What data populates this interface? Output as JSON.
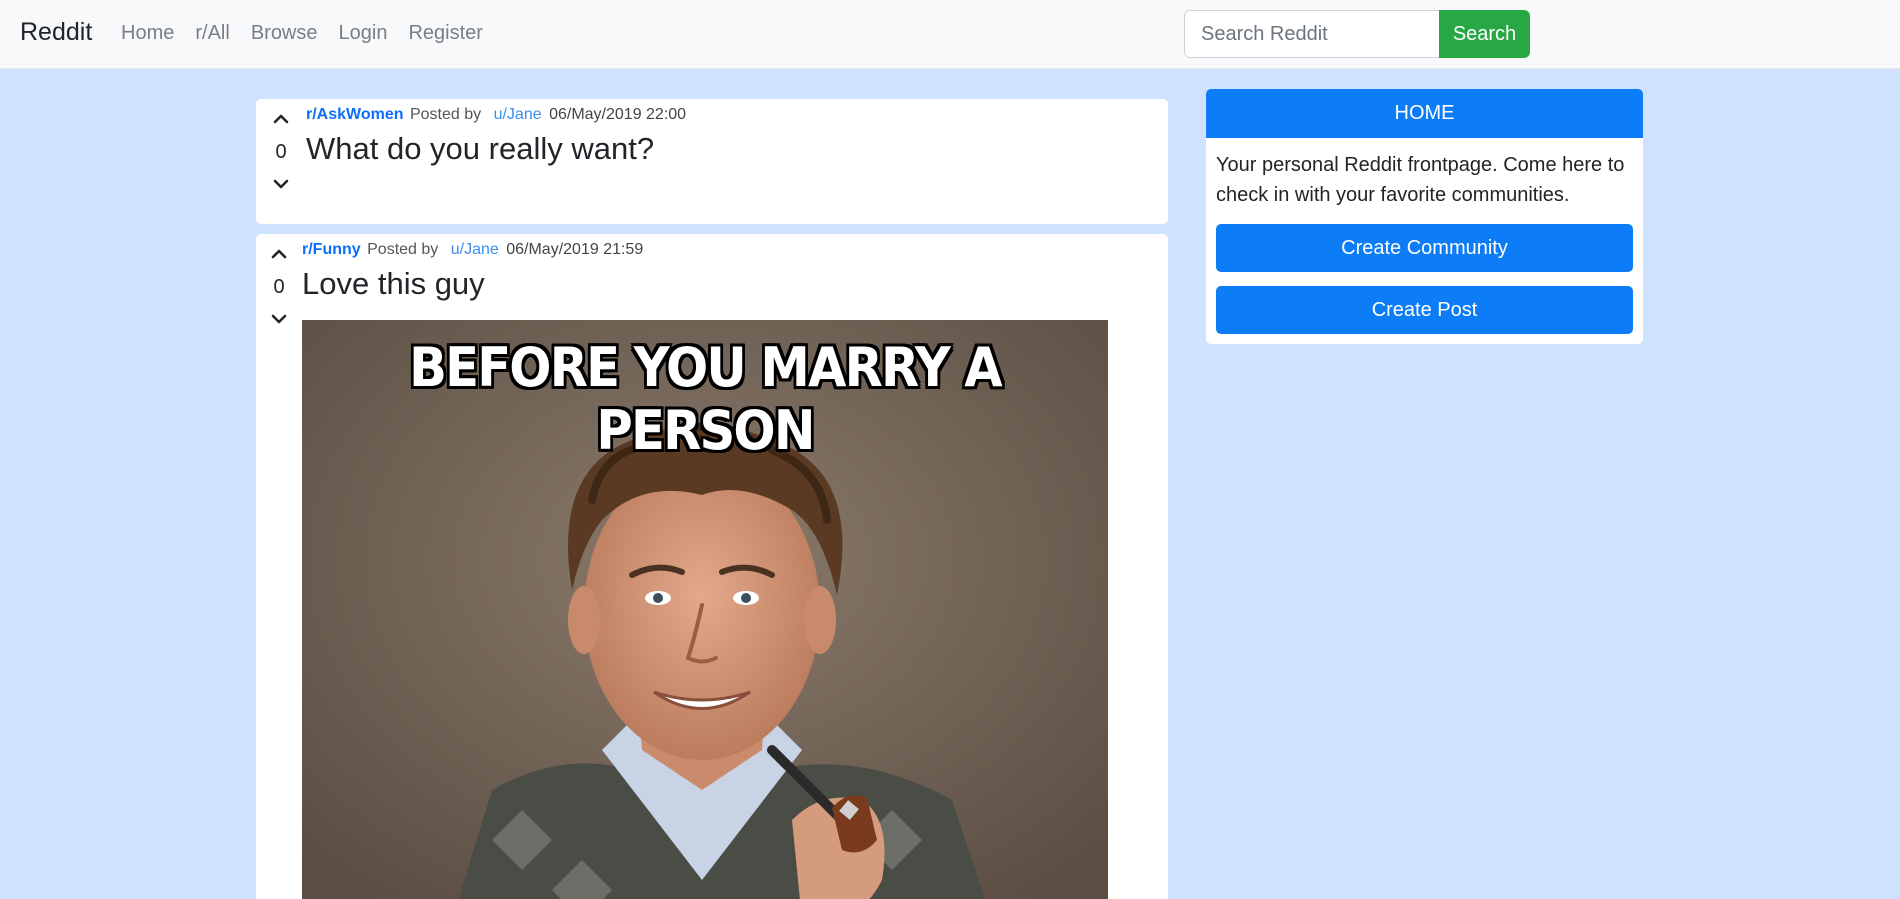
{
  "navbar": {
    "brand": "Reddit",
    "links": [
      "Home",
      "r/All",
      "Browse",
      "Login",
      "Register"
    ],
    "search_placeholder": "Search Reddit",
    "search_button": "Search"
  },
  "posts": [
    {
      "subreddit": "r/AskWomen",
      "posted_by": "Posted by",
      "user": "u/Jane",
      "date": "06/May/2019 22:00",
      "title": "What do you really want?",
      "score": "0"
    },
    {
      "subreddit": "r/Funny",
      "posted_by": "Posted by",
      "user": "u/Jane",
      "date": "06/May/2019 21:59",
      "title": "Love this guy",
      "score": "0",
      "image_caption": "BEFORE YOU MARRY A PERSON"
    }
  ],
  "sidebar": {
    "header": "HOME",
    "description": "Your personal Reddit frontpage. Come here to check in with your favorite communities.",
    "create_community": "Create Community",
    "create_post": "Create Post"
  },
  "colors": {
    "background": "#cfe2ff",
    "primary": "#0d7cf7",
    "success": "#28a745",
    "link": "#0d6efd"
  }
}
